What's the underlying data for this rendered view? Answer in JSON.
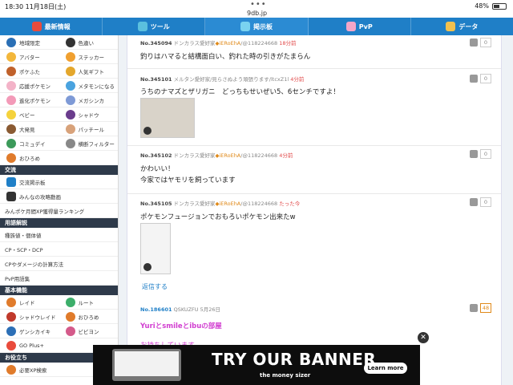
{
  "status": {
    "time": "18:30",
    "date": "11月18日(土)",
    "url": "9db.jp",
    "battery": "48%",
    "battery_level": 0.48
  },
  "nav": [
    {
      "label": "最新情報",
      "icon": "calendar-icon",
      "color": "#e94b3c"
    },
    {
      "label": "ツール",
      "icon": "tools-icon",
      "color": "#5bc0de"
    },
    {
      "label": "掲示板",
      "icon": "chat-icon",
      "color": "#7ad3f0"
    },
    {
      "label": "PvP",
      "icon": "pvp-icon",
      "color": "#f4a6c8"
    },
    {
      "label": "データ",
      "icon": "data-icon",
      "color": "#f2c14e"
    }
  ],
  "sidebar": {
    "grid_top": [
      {
        "label": "地域限定",
        "icon": "globe-icon",
        "color": "#2a6fb5"
      },
      {
        "label": "色違い",
        "icon": "sparkle-icon",
        "color": "#333"
      },
      {
        "label": "アバター",
        "icon": "avatar-icon",
        "color": "#f3b73b"
      },
      {
        "label": "ステッカー",
        "icon": "sticker-icon",
        "color": "#f0a030"
      },
      {
        "label": "ポケふた",
        "icon": "manhole-icon",
        "color": "#c0612b"
      },
      {
        "label": "人気ギフト",
        "icon": "gift-icon",
        "color": "#e4a72c"
      },
      {
        "label": "応援ポケモン",
        "icon": "pokemon-icon",
        "color": "#f3b3c8"
      },
      {
        "label": "メタモンになる",
        "icon": "ditto-icon",
        "color": "#4aa3df"
      },
      {
        "label": "進化ポケモン",
        "icon": "evolve-icon",
        "color": "#f39ab8"
      },
      {
        "label": "メガシンカ",
        "icon": "mega-icon",
        "color": "#7e9ad6"
      },
      {
        "label": "ベビー",
        "icon": "baby-icon",
        "color": "#f5d23c"
      },
      {
        "label": "シャドウ",
        "icon": "shadow-icon",
        "color": "#6a3c8c"
      },
      {
        "label": "大発見",
        "icon": "discovery-icon",
        "color": "#8a5a32"
      },
      {
        "label": "パッチール",
        "icon": "spinda-icon",
        "color": "#d8a27a"
      },
      {
        "label": "コミュデイ",
        "icon": "community-icon",
        "color": "#3c9a5a"
      },
      {
        "label": "横断フィルター",
        "icon": "filter-icon",
        "color": "#888"
      },
      {
        "label": "おひろめ",
        "icon": "showcase-icon",
        "color": "#e07b2b"
      }
    ],
    "exchange": {
      "title": "交流",
      "items": [
        {
          "label": "交流掲示板",
          "icon": "board-icon",
          "color": "#1f7fc7"
        },
        {
          "label": "みんなの攻略動画",
          "icon": "video-icon",
          "color": "#333"
        },
        {
          "label": "みんポケ月間XP獲得量ランキング",
          "icon": "",
          "color": ""
        }
      ]
    },
    "glossary": {
      "title": "用語解説",
      "items": [
        {
          "label": "種族値・個体値"
        },
        {
          "label": "CP・SCP・DCP"
        },
        {
          "label": "CPやダメージの計算方法"
        },
        {
          "label": "PvP用語集"
        }
      ]
    },
    "basic": {
      "title": "基本機能",
      "items": [
        {
          "label": "レイド",
          "icon": "raid-icon",
          "color": "#e07b2b"
        },
        {
          "label": "ルート",
          "icon": "route-icon",
          "color": "#3cae6a"
        },
        {
          "label": "シャドウレイド",
          "icon": "shadow-raid-icon",
          "color": "#c0392b"
        },
        {
          "label": "おひろめ",
          "icon": "showcase-icon",
          "color": "#e07b2b"
        },
        {
          "label": "ゲンシカイキ",
          "icon": "primal-icon",
          "color": "#2c6fb6"
        },
        {
          "label": "ビビヨン",
          "icon": "vivillon-icon",
          "color": "#d45a8a"
        },
        {
          "label": "GO Plus+",
          "icon": "goplus-icon",
          "color": "#e94b3c"
        }
      ]
    },
    "useful": {
      "title": "お役立ち",
      "items": [
        {
          "label": "必要XP検索",
          "icon": "xp-icon",
          "color": "#e07b2b"
        }
      ]
    }
  },
  "posts": [
    {
      "id": "No.345094",
      "author": "ドンカラス愛好家",
      "tag": "◆iERoEhA",
      "uid": "/@118224668",
      "time": "18分前",
      "text": [
        "釣りはハマると結構面白い、釣れた時の引きがたまらん"
      ],
      "likes": "0"
    },
    {
      "id": "No.345101",
      "author": "メルタン愛好家/見らさぬよう頑張ります/ltcxZ1l",
      "tag": "",
      "uid": "",
      "time": "4分前",
      "text": [
        "うちのナマズとザリガニ　どっちもせいぜい5、6センチですよ！"
      ],
      "likes": "0"
    },
    {
      "id": "No.345102",
      "author": "ドンカラス愛好家",
      "tag": "◆iERoEhA",
      "uid": "/@118224668",
      "time": "4分前",
      "text": [
        "かわいい！",
        "今家ではヤモリを飼っています"
      ],
      "likes": "0"
    },
    {
      "id": "No.345105",
      "author": "ドンカラス愛好家",
      "tag": "◆iERoEhA",
      "uid": "/@118224668",
      "time": "たった今",
      "text": [
        "ポケモンフュージョンでおもろいポケモン出来たw"
      ],
      "likes": "0"
    }
  ],
  "reply_label": "返信する",
  "thread2": {
    "id": "No.186601",
    "author": "QSKUZFU",
    "date": "5月26日",
    "likes": "48",
    "title": "Yuriとsmileとibuの部屋",
    "more": "お持ちしています"
  },
  "banner": {
    "headline": "TRY OUR BANNER",
    "logo": "the money sizer",
    "cta": "Learn more",
    "close": "✕"
  }
}
